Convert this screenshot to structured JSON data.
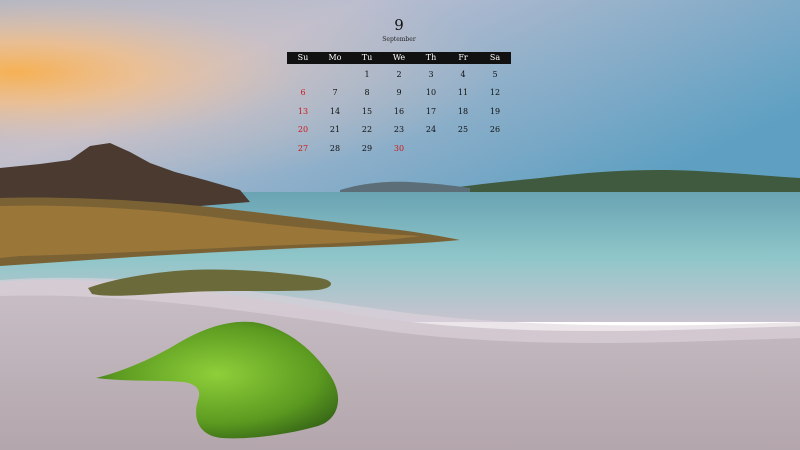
{
  "calendar": {
    "month_number": "9",
    "month_name": "September",
    "weekdays": [
      "Su",
      "Mo",
      "Tu",
      "We",
      "Th",
      "Fr",
      "Sa"
    ],
    "weeks": [
      [
        "",
        "",
        "1",
        "2",
        "3",
        "4",
        "5"
      ],
      [
        "6",
        "7",
        "8",
        "9",
        "10",
        "11",
        "12"
      ],
      [
        "13",
        "14",
        "15",
        "16",
        "17",
        "18",
        "19"
      ],
      [
        "20",
        "21",
        "22",
        "23",
        "24",
        "25",
        "26"
      ],
      [
        "27",
        "28",
        "29",
        "30",
        "",
        "",
        ""
      ]
    ],
    "holidays": [
      "30"
    ],
    "colors": {
      "sunday": "#d01818",
      "holiday": "#d01818",
      "header_bg": "#111111",
      "text": "#111111"
    }
  }
}
